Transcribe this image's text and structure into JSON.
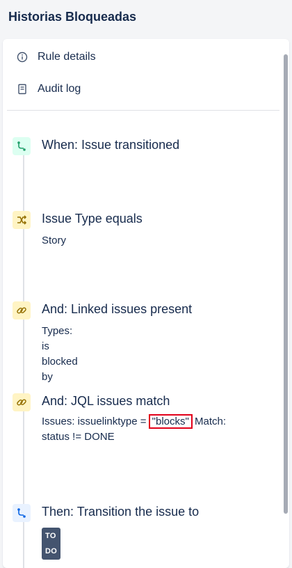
{
  "header": {
    "title": "Historias Bloqueadas"
  },
  "menu": {
    "rule_details": "Rule details",
    "audit_log": "Audit log"
  },
  "steps": [
    {
      "icon": "branch-icon",
      "heading": "When: Issue transitioned",
      "color": "#22a06b"
    },
    {
      "icon": "shuffle-icon",
      "heading": "Issue Type equals",
      "detail": "Story",
      "color": "#946f00"
    },
    {
      "icon": "link-icon",
      "heading": "And: Linked issues present",
      "detail": "Types: is blocked by",
      "color": "#946f00"
    },
    {
      "icon": "link-icon",
      "heading": "And: JQL issues match",
      "detail_prefix": "Issues: issuelinktype = ",
      "detail_highlight": "\"blocks\"",
      "detail_suffix": " Match:",
      "detail_line2": "status != DONE",
      "color": "#946f00"
    },
    {
      "icon": "branch-icon",
      "heading": "Then: Transition the issue to",
      "status": "TO DO",
      "color": "#0c66e4"
    }
  ]
}
